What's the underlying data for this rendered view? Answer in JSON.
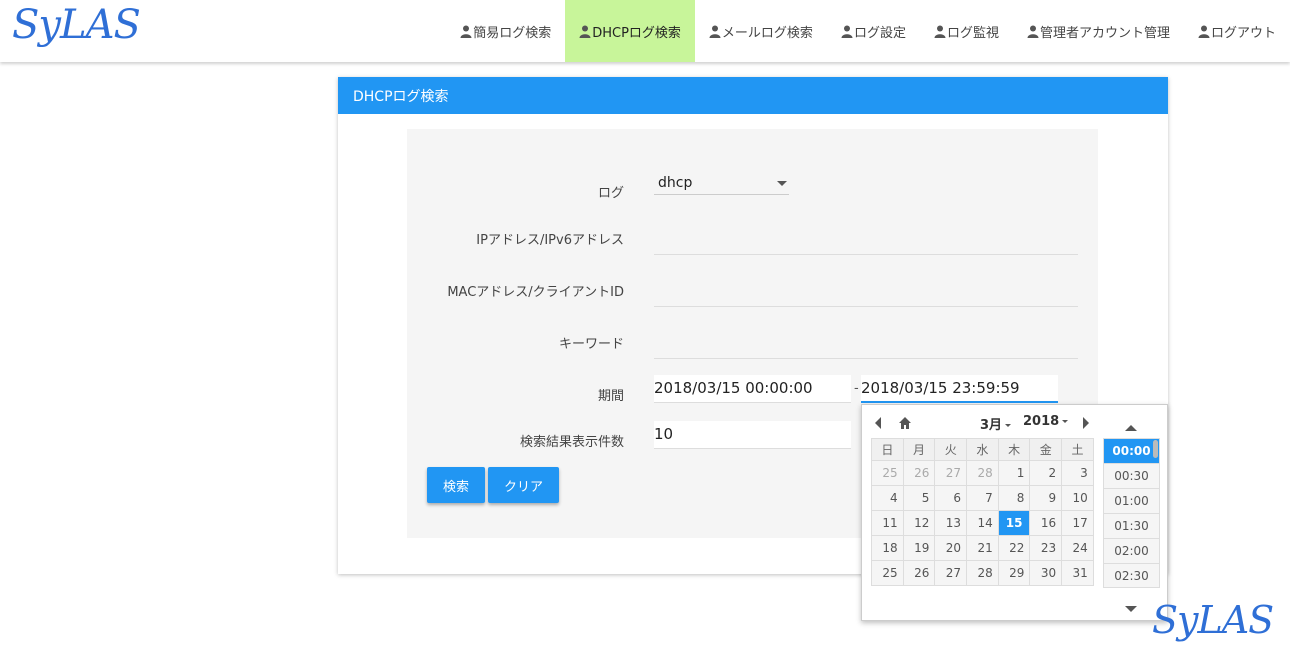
{
  "brand": {
    "logo": "SyLAS",
    "color": "#2f6fd6"
  },
  "nav": [
    {
      "label": "簡易ログ検索",
      "active": false
    },
    {
      "label": "DHCPログ検索",
      "active": true
    },
    {
      "label": "メールログ検索",
      "active": false
    },
    {
      "label": "ログ設定",
      "active": false
    },
    {
      "label": "ログ監視",
      "active": false
    },
    {
      "label": "管理者アカウント管理",
      "active": false
    },
    {
      "label": "ログアウト",
      "active": false
    }
  ],
  "panel": {
    "title": "DHCPログ検索"
  },
  "form": {
    "log_label": "ログ",
    "log_value": "dhcp",
    "ip_label": "IPアドレス/IPv6アドレス",
    "ip_value": "",
    "mac_label": "MACアドレス/クライアントID",
    "mac_value": "",
    "keyword_label": "キーワード",
    "keyword_value": "",
    "period_label": "期間",
    "period_from": "2018/03/15 00:00:00",
    "period_separator": "-",
    "period_to": "2018/03/15 23:59:59",
    "count_label": "検索結果表示件数",
    "count_value": "10",
    "search_button": "検索",
    "clear_button": "クリア"
  },
  "picker": {
    "month": "3月",
    "year": "2018",
    "weekdays": [
      "日",
      "月",
      "火",
      "水",
      "木",
      "金",
      "土"
    ],
    "weeks": [
      [
        25,
        26,
        27,
        28,
        1,
        2,
        3
      ],
      [
        4,
        5,
        6,
        7,
        8,
        9,
        10
      ],
      [
        11,
        12,
        13,
        14,
        15,
        16,
        17
      ],
      [
        18,
        19,
        20,
        21,
        22,
        23,
        24
      ],
      [
        25,
        26,
        27,
        28,
        29,
        30,
        31
      ]
    ],
    "selected_day": 15,
    "times": [
      "00:00",
      "00:30",
      "01:00",
      "01:30",
      "02:00",
      "02:30"
    ],
    "selected_time": "00:00"
  },
  "colors": {
    "accent": "#2196f3",
    "active_nav": "#c8f59a"
  }
}
